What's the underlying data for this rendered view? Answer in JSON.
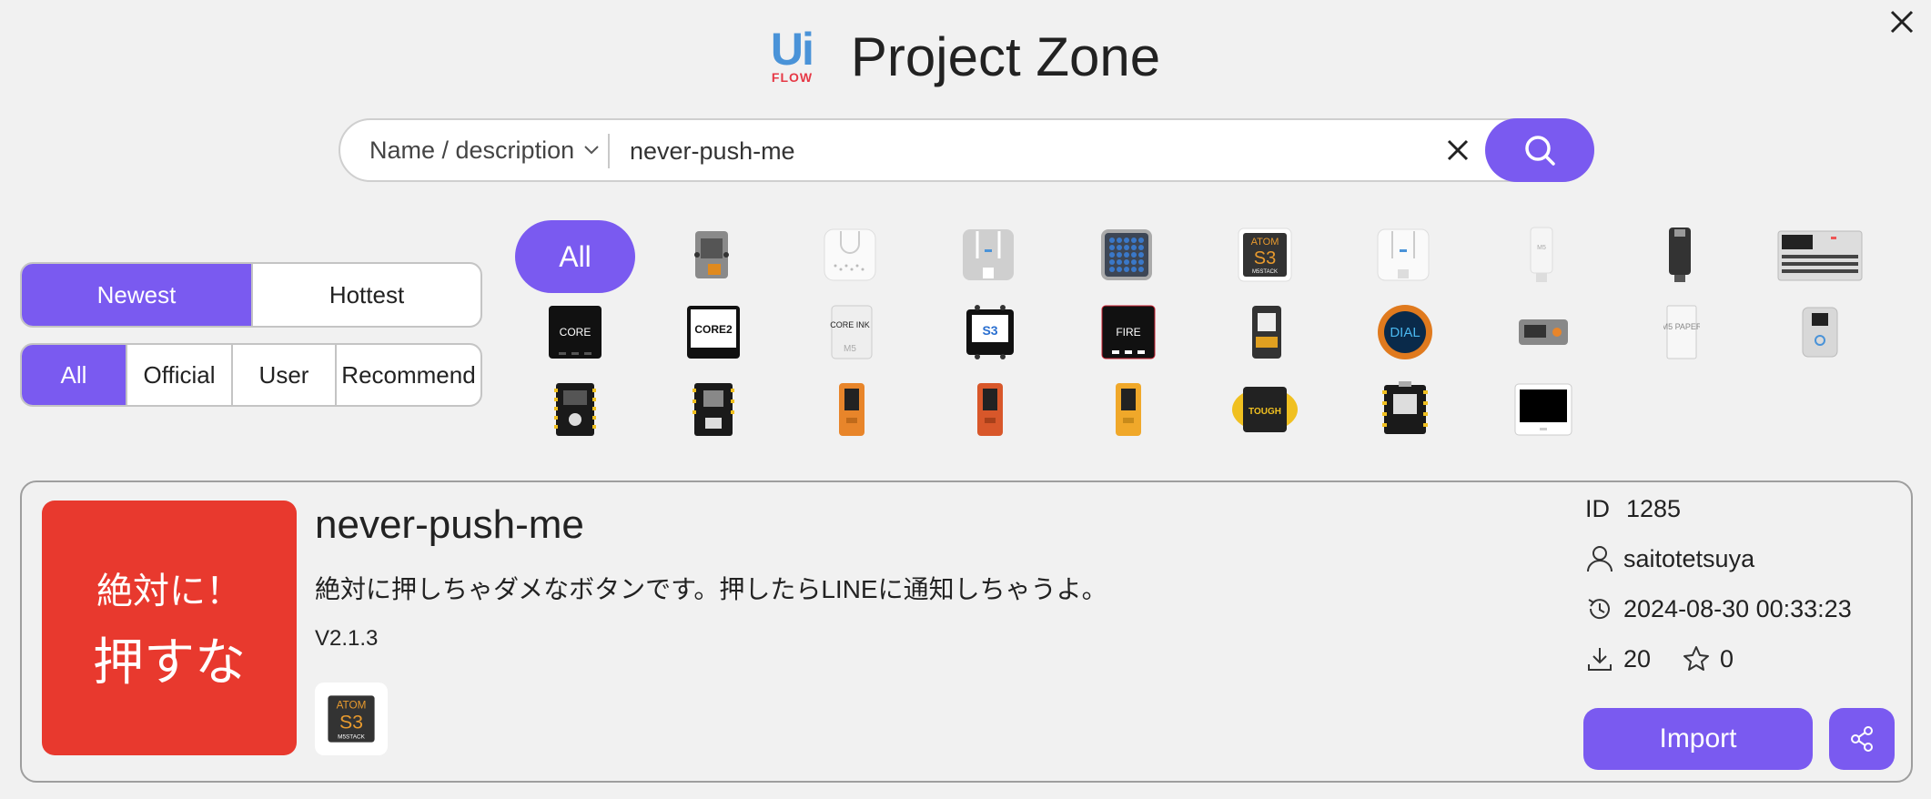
{
  "header": {
    "logo_text": "Ui",
    "logo_sub": "FLOW",
    "title": "Project Zone"
  },
  "search": {
    "mode_label": "Name / description",
    "query": "never-push-me"
  },
  "sort": {
    "newest": "Newest",
    "hottest": "Hottest",
    "active": "Newest"
  },
  "filter": {
    "all": "All",
    "official": "Official",
    "user": "User",
    "recommend": "Recommend",
    "active": "All"
  },
  "devices": {
    "all_label": "All",
    "icon_labels": {
      "core": "CORE",
      "core2": "CORE2",
      "coreink": "CORE INK",
      "cores3": "S3",
      "fire": "FIRE",
      "dial": "DIAL",
      "tough": "TOUGH",
      "atom_s3_top": "ATOM",
      "atom_s3_mid": "S3",
      "atom_s3_bottom": "M5STACK",
      "paper": "M5 PAPER"
    }
  },
  "project": {
    "thumb_line1": "絶対に！",
    "thumb_line2": "押すな",
    "title": "never-push-me",
    "description": "絶対に押しちゃダメなボタンです。押したらLINEに通知しちゃうよ。",
    "version": "V2.1.3",
    "id_label": "ID",
    "id": "1285",
    "author": "saitotetsuya",
    "updated": "2024-08-30 00:33:23",
    "downloads": "20",
    "stars": "0",
    "import_label": "Import"
  },
  "colors": {
    "accent": "#7a5af0",
    "thumb_bg": "#e8392e"
  }
}
